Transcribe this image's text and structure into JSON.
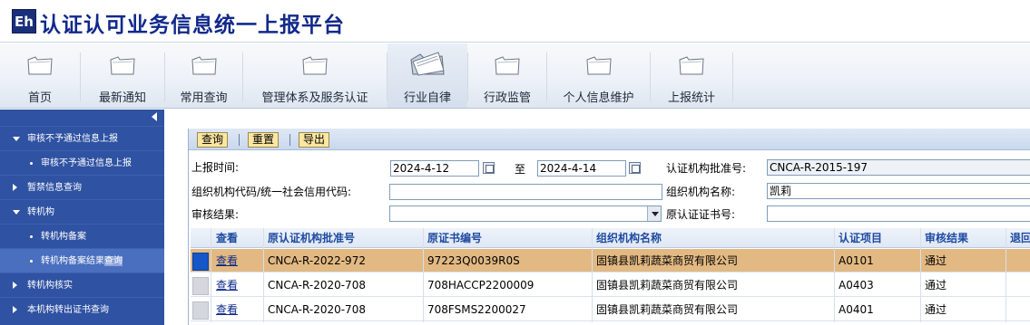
{
  "app": {
    "logo_text": "Eh",
    "title": "认证认可业务信息统一上报平台"
  },
  "nav": {
    "items": [
      {
        "label": "首页"
      },
      {
        "label": "最新通知"
      },
      {
        "label": "常用查询"
      },
      {
        "label": "管理体系及服务认证"
      },
      {
        "label": "行业自律"
      },
      {
        "label": "行政监管"
      },
      {
        "label": "个人信息维护"
      },
      {
        "label": "上报统计"
      }
    ],
    "active_label": "行业自律"
  },
  "sidebar": {
    "items": [
      {
        "label": "审核不予通过信息上报",
        "level": 1,
        "expanded": true
      },
      {
        "label": "审核不予通过信息上报",
        "level": 2
      },
      {
        "label": "暂禁信息查询",
        "level": 1,
        "expanded": false
      },
      {
        "label": "转机构",
        "level": 1,
        "expanded": true
      },
      {
        "label": "转机构备案",
        "level": 2
      },
      {
        "label_main": "转机构备案结果",
        "label_hl": "查询",
        "level": 2,
        "selected": true
      },
      {
        "label": "转机构核实",
        "level": 1,
        "expanded": false
      },
      {
        "label": "本机构转出证书查询",
        "level": 1,
        "expanded": false
      }
    ]
  },
  "toolbar": {
    "query_label": "查询",
    "reset_label": "重置",
    "export_label": "导出"
  },
  "form": {
    "report_time_label": "上报时间:",
    "date_from": "2024-4-12",
    "to_label": "至",
    "date_to": "2024-4-14",
    "approval_no_label": "认证机构批准号:",
    "approval_no_value": "CNCA-R-2015-197",
    "org_code_label": "组织机构代码/统一社会信用代码:",
    "org_code_value": "",
    "org_name_label": "组织机构名称:",
    "org_name_value": "凯莉",
    "review_result_label": "审核结果:",
    "review_result_value": "",
    "orig_cert_label": "原认证证书号:",
    "orig_cert_value": ""
  },
  "grid": {
    "columns": [
      "查看",
      "原认证机构批准号",
      "原证书编号",
      "组织机构名称",
      "认证项目",
      "审核结果",
      "退回"
    ],
    "rows": [
      {
        "view": "查看",
        "approval_no": "CNCA-R-2022-972",
        "cert_no": "97223Q0039R0S",
        "org_name": "固镇县凯莉蔬菜商贸有限公司",
        "project": "A0101",
        "result": "通过",
        "selected": true
      },
      {
        "view": "查看",
        "approval_no": "CNCA-R-2020-708",
        "cert_no": "708HACCP2200009",
        "org_name": "固镇县凯莉蔬菜商贸有限公司",
        "project": "A0403",
        "result": "通过"
      },
      {
        "view": "查看",
        "approval_no": "CNCA-R-2020-708",
        "cert_no": "708FSMS2200027",
        "org_name": "固镇县凯莉蔬菜商贸有限公司",
        "project": "A0401",
        "result": "通过"
      }
    ]
  },
  "colors": {
    "header_title": "#10298a",
    "sidebar_bg": "#2f52a2",
    "selected_row": "#e2b982",
    "toolbar_button": "#fbe6a2"
  }
}
